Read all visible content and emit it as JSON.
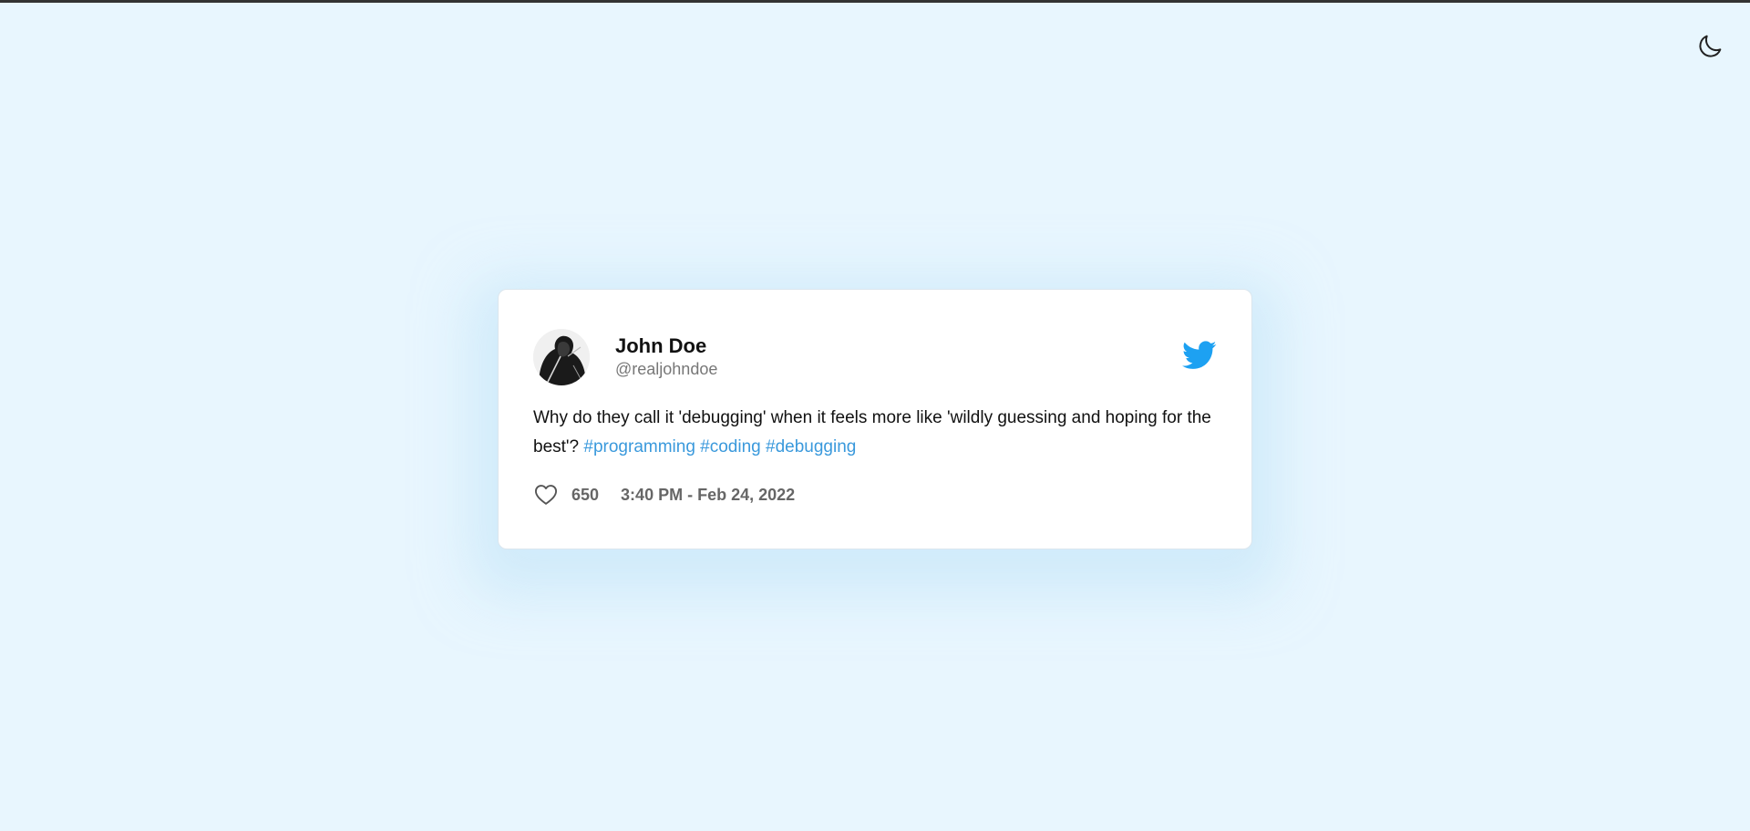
{
  "theme_toggle": {
    "icon": "moon-icon"
  },
  "tweet": {
    "author_name": "John Doe",
    "author_handle": "@realjohndoe",
    "text_plain": "Why do they call it 'debugging' when it feels more like 'wildly guessing and hoping for the best'?",
    "hashtags": [
      "#programming",
      "#coding",
      "#debugging"
    ],
    "likes": "650",
    "timestamp": "3:40 PM - Feb 24, 2022",
    "brand_icon": "twitter-bird-icon",
    "like_icon": "heart-icon"
  },
  "colors": {
    "background": "#e8f6fe",
    "card": "#ffffff",
    "hashtag": "#3a99dc",
    "twitter_blue": "#1da1f2",
    "muted_text": "#666666"
  }
}
